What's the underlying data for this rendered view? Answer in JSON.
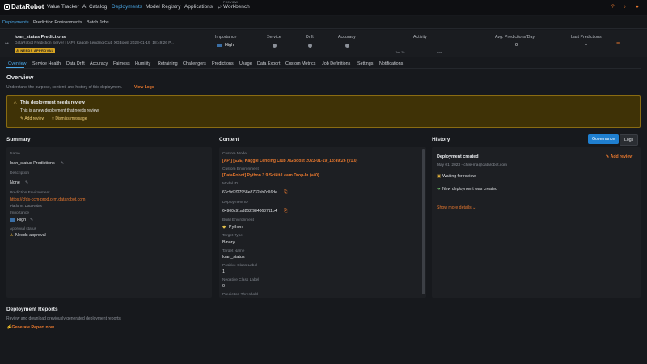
{
  "brand": {
    "name": "DataRobot"
  },
  "nav": {
    "items": [
      "Value Tracker",
      "AI Catalog",
      "Deployments",
      "Model Registry",
      "Applications",
      "Workbench"
    ],
    "preview_tag": "PREVIEW",
    "help": "?",
    "bell": "♪",
    "user": "●"
  },
  "subnav": {
    "items": [
      "Deployments",
      "Prediction Environments",
      "Batch Jobs"
    ]
  },
  "deployment": {
    "name": "loan_status Predictions",
    "server": "DataRobot Prediction Server | [API] Kaggle Lending Club XGBoost 2023-01-19_18:49:26 P...",
    "badge": "NEEDS APPROVAL",
    "headers": {
      "importance": "Importance",
      "service": "Service",
      "drift": "Drift",
      "accuracy": "Accuracy",
      "activity": "Activity",
      "avg_predictions": "Avg. Predictions/Day",
      "last_predictions": "Last Predictions"
    },
    "importance_value": "High",
    "avg_predictions_value": "0",
    "last_predictions_value": "–",
    "activity_range": {
      "start": "Jan 20",
      "end": "now"
    }
  },
  "tabs": [
    "Overview",
    "Service Health",
    "Data Drift",
    "Accuracy",
    "Fairness",
    "Humility",
    "Retraining",
    "Challengers",
    "Predictions",
    "Usage",
    "Data Export",
    "Custom Metrics",
    "Job Definitions",
    "Settings",
    "Notifications"
  ],
  "overview": {
    "title": "Overview",
    "subtitle": "Understand the purpose, content, and history of this deployment.",
    "view_logs": "View Logs"
  },
  "warning": {
    "title": "This deployment needs review",
    "message": "This is a new deployment that needs review.",
    "add_review": "Add review",
    "dismiss": "Dismiss message"
  },
  "summary": {
    "title": "Summary",
    "name_label": "Name",
    "name_value": "loan_status Predictions",
    "description_label": "Description",
    "description_value": "None",
    "env_label": "Prediction Environment",
    "env_value": "https://cfds-ccm-prod.orm.datarobot.com",
    "platform": "Platform: DataRobot",
    "importance_label": "Importance",
    "importance_value": "High",
    "approval_label": "Approval status",
    "approval_value": "Needs approval"
  },
  "content": {
    "title": "Content",
    "custom_model_label": "Custom Model",
    "custom_model_value": "[API] [E2E] Kaggle Lending Club XGBoost 2023-01-19_18:49:26 (v1.0)",
    "custom_env_label": "Custom Environment",
    "custom_env_value": "[DataRobot] Python 3.9 Scikit-Learn Drop-In (v40)",
    "model_id_label": "Model ID",
    "model_id_value": "63c9d7f27958e8732eb7d16de",
    "deployment_id_label": "Deployment ID",
    "deployment_id_value": "64900c91a9262f984063711b4",
    "build_env_label": "Build Environment",
    "build_env_value": "Python",
    "target_type_label": "Target Type",
    "target_type_value": "Binary",
    "target_name_label": "Target Name",
    "target_name_value": "loan_status",
    "positive_label": "Positive Class Label",
    "positive_value": "1",
    "negative_label": "Negative Class Label",
    "negative_value": "0",
    "threshold_label": "Prediction Threshold"
  },
  "history": {
    "title": "History",
    "governance_btn": "Governance",
    "logs_btn": "Logs",
    "event_title": "Deployment created",
    "add_review": "Add review",
    "event_date": "May 01, 2023 - chile-ma@datarobot.com",
    "waiting": "Waiting for review",
    "created": "New deployment was created",
    "show_more": "Show more details"
  },
  "reports": {
    "title": "Deployment Reports",
    "subtitle": "Review and download previously generated deployment reports.",
    "generate": "Generate Report now"
  },
  "colors": {
    "accent": "#4aa8e8",
    "warning_bg": "#3f3206",
    "link": "#e8782e",
    "primary_btn": "#1f7fd0"
  }
}
